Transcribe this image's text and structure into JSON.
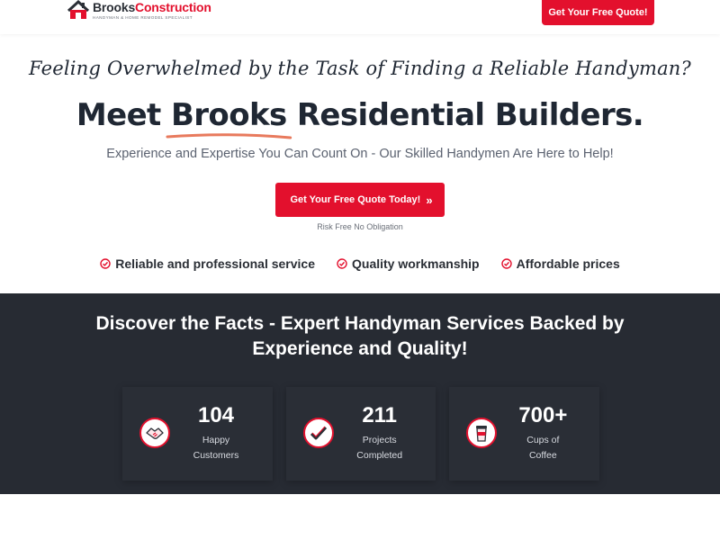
{
  "header": {
    "logo": {
      "name_part1": "Brooks",
      "name_part2": "Construction",
      "tagline": "HANDYMAN & HOME REMODEL SPECIALIST"
    },
    "cta_label": "Get Your Free Quote!"
  },
  "hero": {
    "script_line": "Feeling Overwhelmed by the Task of Finding a Reliable Handyman?",
    "title_part1": "Meet ",
    "title_highlight": "Brooks",
    "title_part2": " Residential Builders.",
    "subtitle": "Experience and Expertise You Can Count On - Our Skilled Handymen Are Here to Help!",
    "cta_label": "Get Your Free Quote Today!",
    "cta_chevron": "»",
    "cta_note": "Risk Free No Obligation"
  },
  "features": [
    {
      "label": "Reliable and professional service",
      "icon": "check-circle-icon"
    },
    {
      "label": "Quality workmanship",
      "icon": "check-circle-icon"
    },
    {
      "label": "Affordable prices",
      "icon": "check-circle-icon"
    }
  ],
  "facts": {
    "title_line1": "Discover the Facts - Expert Handyman Services Backed by",
    "title_line2": "Experience and Quality!",
    "stats": [
      {
        "number": "104",
        "line1": "Happy",
        "line2": "Customers",
        "icon": "handshake-icon"
      },
      {
        "number": "211",
        "line1": "Projects",
        "line2": "Completed",
        "icon": "checkmark-icon"
      },
      {
        "number": "700+",
        "line1": "Cups of",
        "line2": "Coffee",
        "icon": "coffee-cup-icon"
      }
    ]
  },
  "colors": {
    "brand_red": "#e3102d",
    "dark_section": "#272b33",
    "text_dark": "#1f2733",
    "underline_accent": "#e87a5d"
  }
}
